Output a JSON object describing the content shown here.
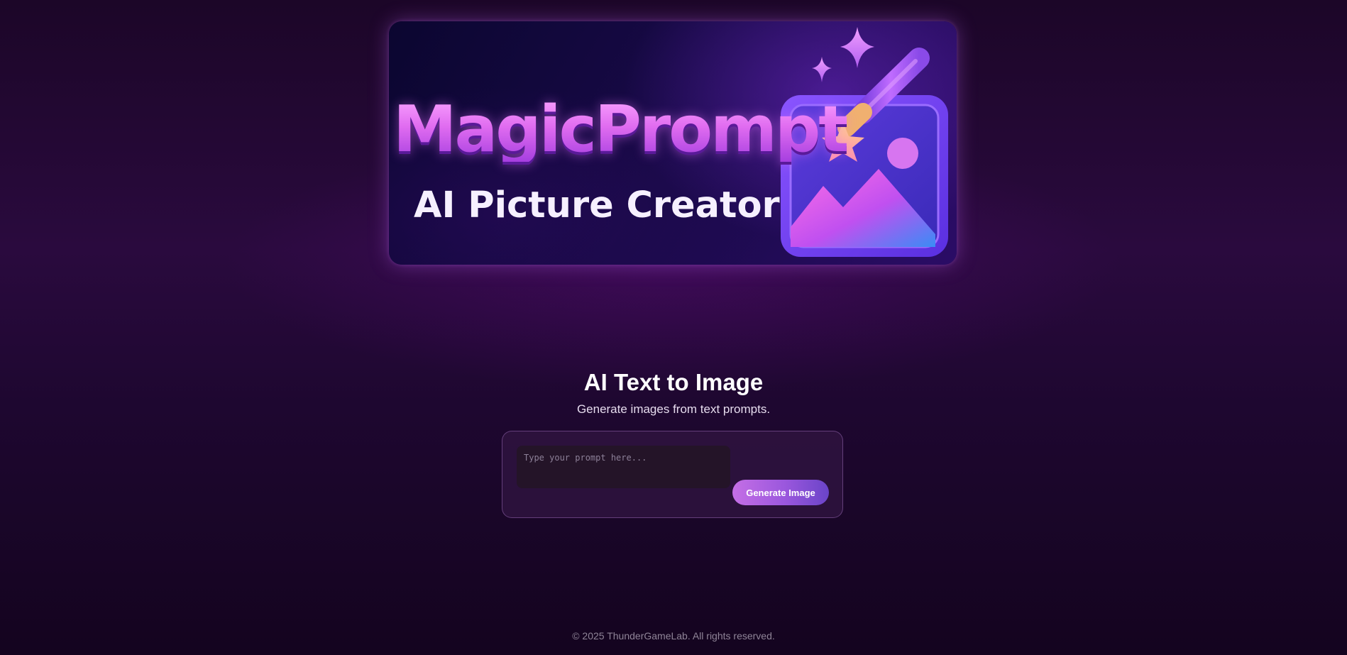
{
  "banner": {
    "brand_name": "MagicPrompt",
    "tagline": "AI Picture Creator",
    "icons": [
      "sparkle-icon",
      "magic-wand-icon",
      "picture-frame-icon"
    ]
  },
  "main": {
    "heading": "AI Text to Image",
    "subheading": "Generate images from text prompts.",
    "prompt_placeholder": "Type your prompt here...",
    "prompt_value": "",
    "generate_label": "Generate Image"
  },
  "footer": {
    "copyright": "© 2025 ThunderGameLab. All rights reserved."
  },
  "colors": {
    "background": "#1c0628",
    "accent": "#c56fe6",
    "accent_secondary": "#6a44c8",
    "brand_text": "#e06cf0"
  }
}
